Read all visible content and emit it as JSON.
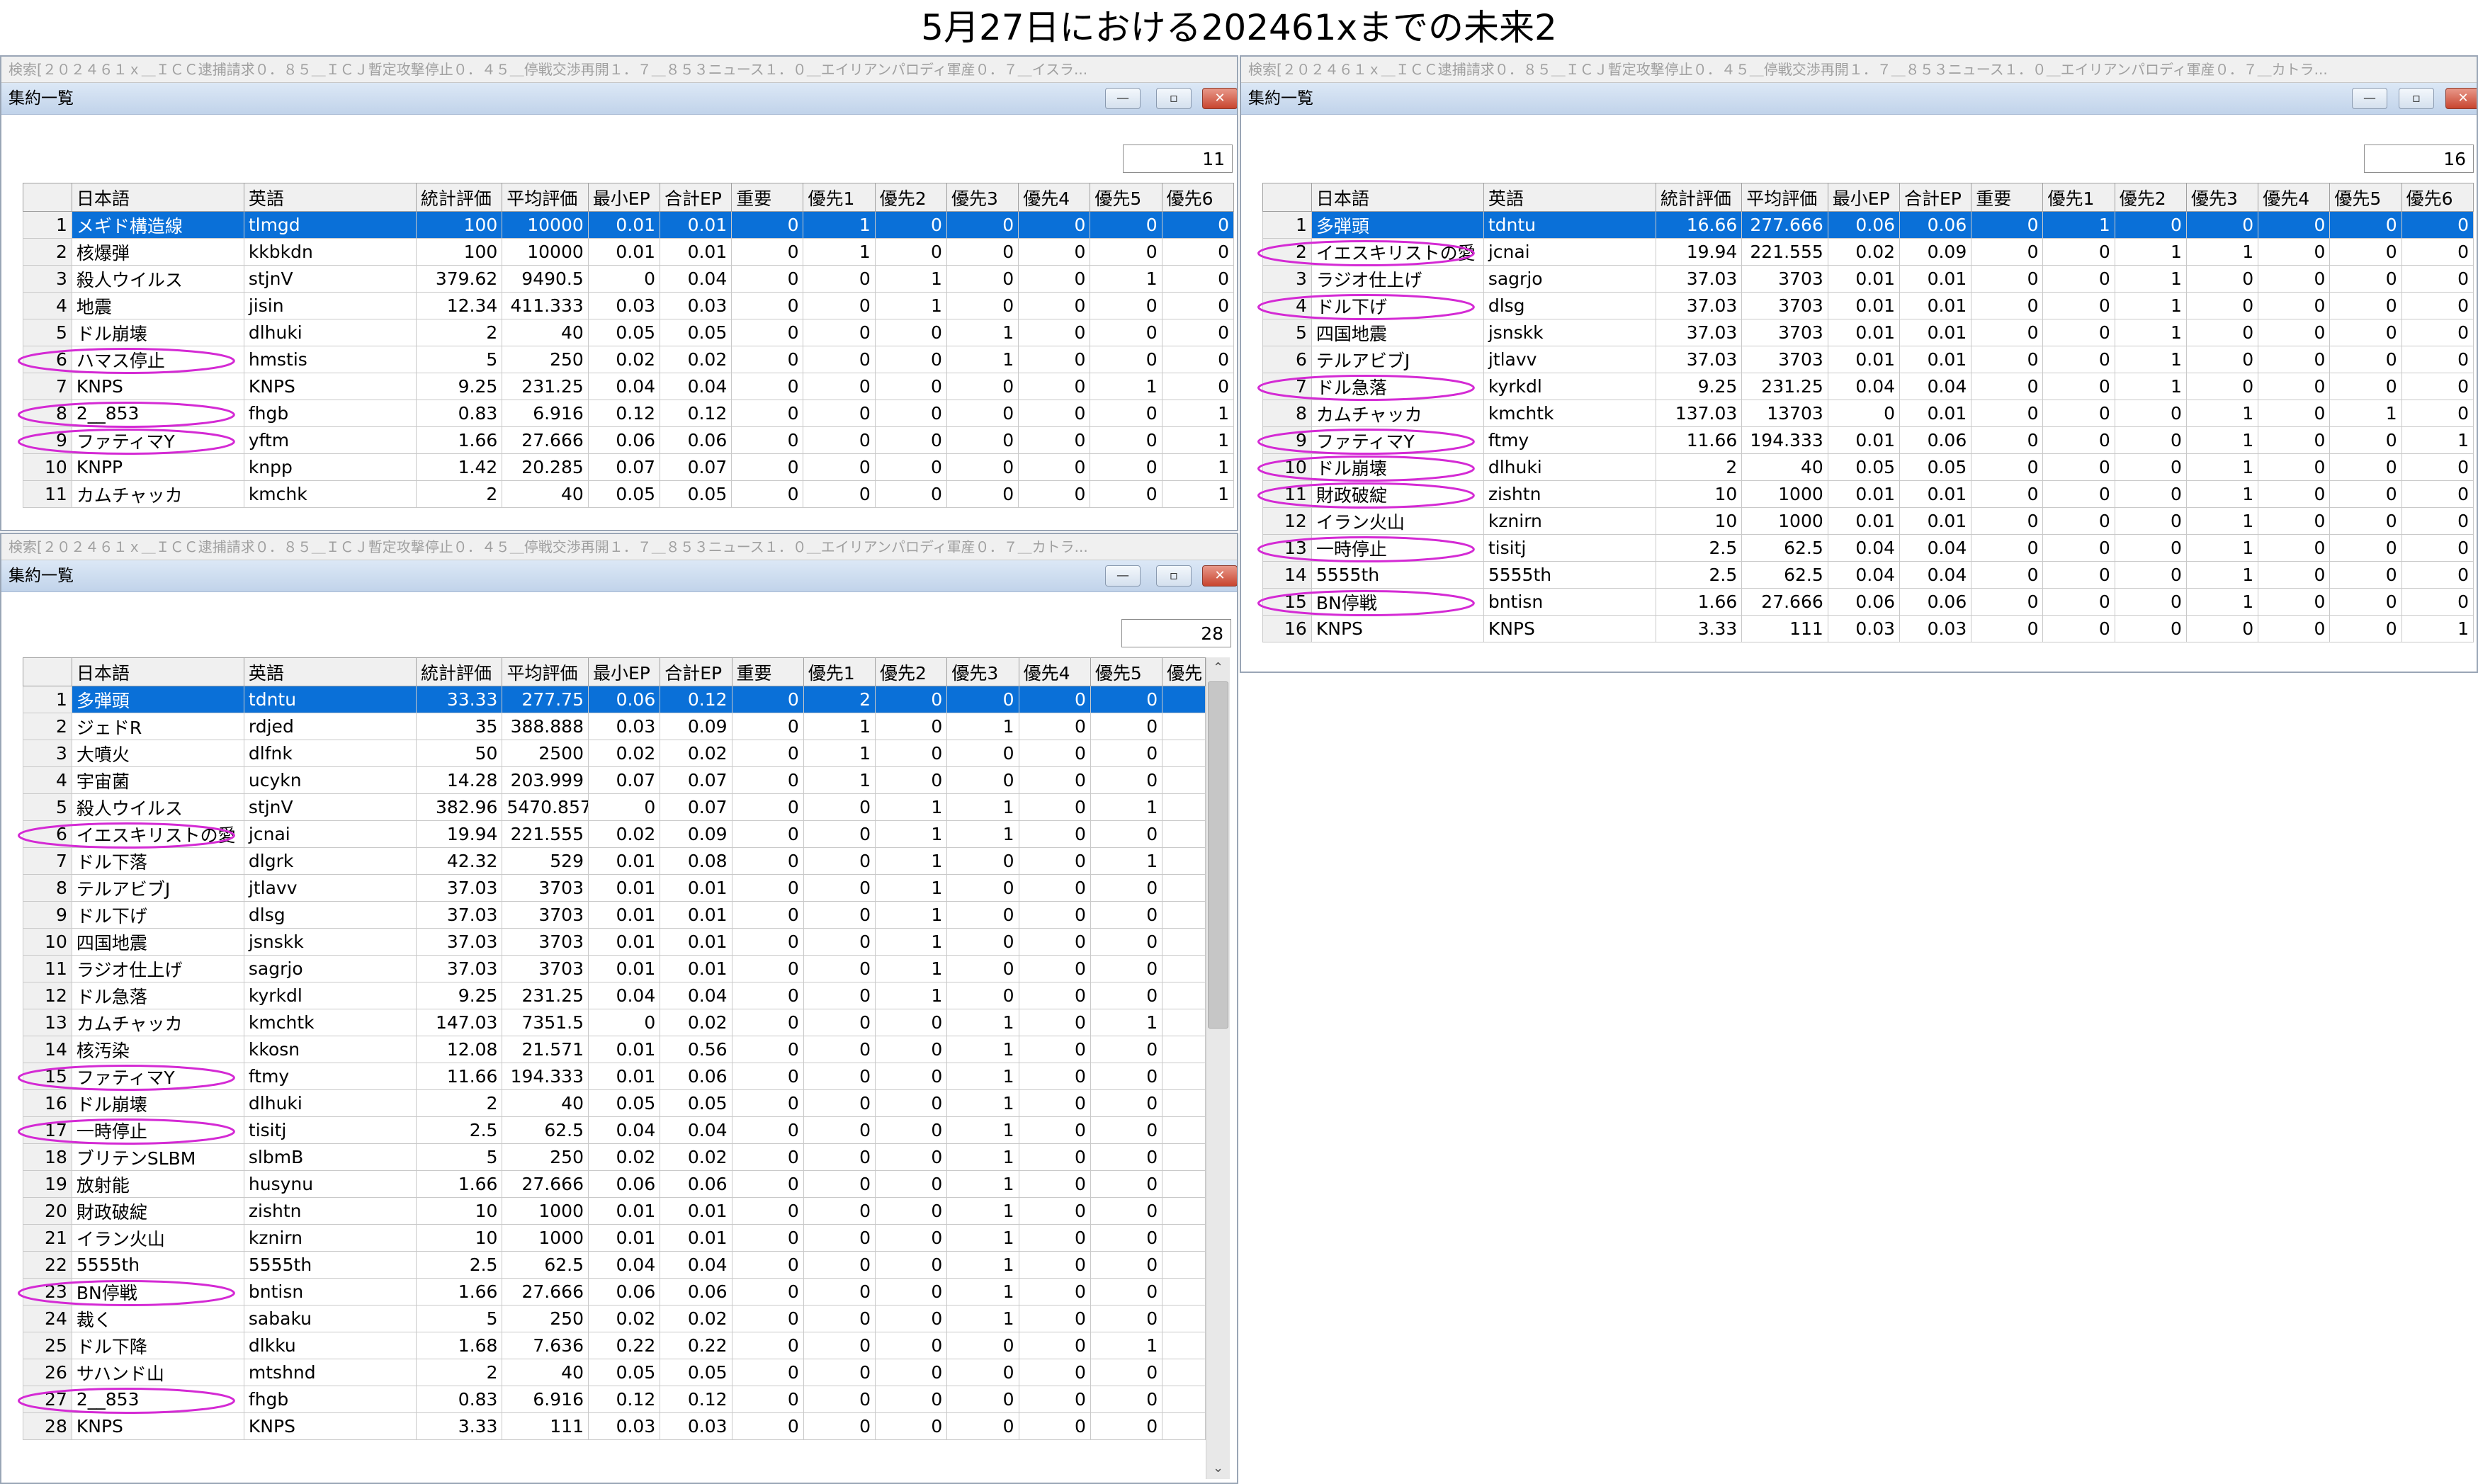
{
  "page": {
    "title": "5月27日における202461xまでの未来2"
  },
  "columns": [
    "日本語",
    "英語",
    "統計評価",
    "平均評価",
    "最小EP",
    "合計EP",
    "重要",
    "優先1",
    "優先2",
    "優先3",
    "優先4",
    "優先5",
    "優先6"
  ],
  "columns_short": [
    "日本語",
    "英語",
    "統計評価",
    "平均評価",
    "最小EP",
    "合計EP",
    "重要",
    "優先1",
    "優先2",
    "優先3",
    "優先4",
    "優先5",
    "優先"
  ],
  "colors": {
    "selection": "#0a70d8",
    "oval": "#d42ad4",
    "close_button": "#c8452f"
  },
  "window_buttons": {
    "minimize": "—",
    "maximize": "▫",
    "close": "✕"
  },
  "scroll_arrows": {
    "up": "⌃",
    "down": "⌄"
  },
  "windows": [
    {
      "id": "top-left",
      "search_text": "検索[２０２４６１ｘ＿ＩＣＣ逮捕請求０．８５＿ＩＣＪ暫定攻撃停止０．４５＿停戦交渉再開１．７＿８５３ニュース１．０＿エイリアンパロディ軍産０．７＿イスラ...",
      "title": "集約一覧",
      "count": "11",
      "rows": [
        {
          "n": "1",
          "ja": "メギド構造線",
          "en": "tlmgd",
          "stat": "100",
          "avg": "10000",
          "min": "0.01",
          "sum": "0.01",
          "imp": "0",
          "p1": "1",
          "p2": "0",
          "p3": "0",
          "p4": "0",
          "p5": "0",
          "p6": "0",
          "sel": true
        },
        {
          "n": "2",
          "ja": "核爆弾",
          "en": "kkbkdn",
          "stat": "100",
          "avg": "10000",
          "min": "0.01",
          "sum": "0.01",
          "imp": "0",
          "p1": "1",
          "p2": "0",
          "p3": "0",
          "p4": "0",
          "p5": "0",
          "p6": "0"
        },
        {
          "n": "3",
          "ja": "殺人ウイルス",
          "en": "stjnV",
          "stat": "379.62",
          "avg": "9490.5",
          "min": "0",
          "sum": "0.04",
          "imp": "0",
          "p1": "0",
          "p2": "1",
          "p3": "0",
          "p4": "0",
          "p5": "1",
          "p6": "0"
        },
        {
          "n": "4",
          "ja": "地震",
          "en": "jisin",
          "stat": "12.34",
          "avg": "411.333",
          "min": "0.03",
          "sum": "0.03",
          "imp": "0",
          "p1": "0",
          "p2": "1",
          "p3": "0",
          "p4": "0",
          "p5": "0",
          "p6": "0"
        },
        {
          "n": "5",
          "ja": "ドル崩壊",
          "en": "dlhuki",
          "stat": "2",
          "avg": "40",
          "min": "0.05",
          "sum": "0.05",
          "imp": "0",
          "p1": "0",
          "p2": "0",
          "p3": "1",
          "p4": "0",
          "p5": "0",
          "p6": "0"
        },
        {
          "n": "6",
          "ja": "ハマス停止",
          "en": "hmstis",
          "stat": "5",
          "avg": "250",
          "min": "0.02",
          "sum": "0.02",
          "imp": "0",
          "p1": "0",
          "p2": "0",
          "p3": "1",
          "p4": "0",
          "p5": "0",
          "p6": "0",
          "oval": true
        },
        {
          "n": "7",
          "ja": "KNPS",
          "en": "KNPS",
          "stat": "9.25",
          "avg": "231.25",
          "min": "0.04",
          "sum": "0.04",
          "imp": "0",
          "p1": "0",
          "p2": "0",
          "p3": "0",
          "p4": "0",
          "p5": "1",
          "p6": "0"
        },
        {
          "n": "8",
          "ja": "2__853",
          "en": "fhgb",
          "stat": "0.83",
          "avg": "6.916",
          "min": "0.12",
          "sum": "0.12",
          "imp": "0",
          "p1": "0",
          "p2": "0",
          "p3": "0",
          "p4": "0",
          "p5": "0",
          "p6": "1",
          "oval": true
        },
        {
          "n": "9",
          "ja": "ファティマY",
          "en": "yftm",
          "stat": "1.66",
          "avg": "27.666",
          "min": "0.06",
          "sum": "0.06",
          "imp": "0",
          "p1": "0",
          "p2": "0",
          "p3": "0",
          "p4": "0",
          "p5": "0",
          "p6": "1",
          "oval": true
        },
        {
          "n": "10",
          "ja": "KNPP",
          "en": "knpp",
          "stat": "1.42",
          "avg": "20.285",
          "min": "0.07",
          "sum": "0.07",
          "imp": "0",
          "p1": "0",
          "p2": "0",
          "p3": "0",
          "p4": "0",
          "p5": "0",
          "p6": "1"
        },
        {
          "n": "11",
          "ja": "カムチャッカ",
          "en": "kmchk",
          "stat": "2",
          "avg": "40",
          "min": "0.05",
          "sum": "0.05",
          "imp": "0",
          "p1": "0",
          "p2": "0",
          "p3": "0",
          "p4": "0",
          "p5": "0",
          "p6": "1"
        }
      ]
    },
    {
      "id": "top-right",
      "search_text": "検索[２０２４６１ｘ＿ＩＣＣ逮捕請求０．８５＿ＩＣＪ暫定攻撃停止０．４５＿停戦交渉再開１．７＿８５３ニュース１．０＿エイリアンパロディ軍産０．７＿カトラ...",
      "title": "集約一覧",
      "count": "16",
      "rows": [
        {
          "n": "1",
          "ja": "多弾頭",
          "en": "tdntu",
          "stat": "16.66",
          "avg": "277.666",
          "min": "0.06",
          "sum": "0.06",
          "imp": "0",
          "p1": "1",
          "p2": "0",
          "p3": "0",
          "p4": "0",
          "p5": "0",
          "p6": "0",
          "sel": true
        },
        {
          "n": "2",
          "ja": "イエスキリストの愛",
          "en": "jcnai",
          "stat": "19.94",
          "avg": "221.555",
          "min": "0.02",
          "sum": "0.09",
          "imp": "0",
          "p1": "0",
          "p2": "1",
          "p3": "1",
          "p4": "0",
          "p5": "0",
          "p6": "0",
          "oval": true
        },
        {
          "n": "3",
          "ja": "ラジオ仕上げ",
          "en": "sagrjo",
          "stat": "37.03",
          "avg": "3703",
          "min": "0.01",
          "sum": "0.01",
          "imp": "0",
          "p1": "0",
          "p2": "1",
          "p3": "0",
          "p4": "0",
          "p5": "0",
          "p6": "0"
        },
        {
          "n": "4",
          "ja": "ドル下げ",
          "en": "dlsg",
          "stat": "37.03",
          "avg": "3703",
          "min": "0.01",
          "sum": "0.01",
          "imp": "0",
          "p1": "0",
          "p2": "1",
          "p3": "0",
          "p4": "0",
          "p5": "0",
          "p6": "0",
          "oval": true
        },
        {
          "n": "5",
          "ja": "四国地震",
          "en": "jsnskk",
          "stat": "37.03",
          "avg": "3703",
          "min": "0.01",
          "sum": "0.01",
          "imp": "0",
          "p1": "0",
          "p2": "1",
          "p3": "0",
          "p4": "0",
          "p5": "0",
          "p6": "0"
        },
        {
          "n": "6",
          "ja": "テルアビブJ",
          "en": "jtlavv",
          "stat": "37.03",
          "avg": "3703",
          "min": "0.01",
          "sum": "0.01",
          "imp": "0",
          "p1": "0",
          "p2": "1",
          "p3": "0",
          "p4": "0",
          "p5": "0",
          "p6": "0"
        },
        {
          "n": "7",
          "ja": "ドル急落",
          "en": "kyrkdl",
          "stat": "9.25",
          "avg": "231.25",
          "min": "0.04",
          "sum": "0.04",
          "imp": "0",
          "p1": "0",
          "p2": "1",
          "p3": "0",
          "p4": "0",
          "p5": "0",
          "p6": "0",
          "oval": true
        },
        {
          "n": "8",
          "ja": "カムチャッカ",
          "en": "kmchtk",
          "stat": "137.03",
          "avg": "13703",
          "min": "0",
          "sum": "0.01",
          "imp": "0",
          "p1": "0",
          "p2": "0",
          "p3": "1",
          "p4": "0",
          "p5": "1",
          "p6": "0"
        },
        {
          "n": "9",
          "ja": "ファティマY",
          "en": "ftmy",
          "stat": "11.66",
          "avg": "194.333",
          "min": "0.01",
          "sum": "0.06",
          "imp": "0",
          "p1": "0",
          "p2": "0",
          "p3": "1",
          "p4": "0",
          "p5": "0",
          "p6": "1",
          "oval": true
        },
        {
          "n": "10",
          "ja": "ドル崩壊",
          "en": "dlhuki",
          "stat": "2",
          "avg": "40",
          "min": "0.05",
          "sum": "0.05",
          "imp": "0",
          "p1": "0",
          "p2": "0",
          "p3": "1",
          "p4": "0",
          "p5": "0",
          "p6": "0",
          "oval": true
        },
        {
          "n": "11",
          "ja": "財政破綻",
          "en": "zishtn",
          "stat": "10",
          "avg": "1000",
          "min": "0.01",
          "sum": "0.01",
          "imp": "0",
          "p1": "0",
          "p2": "0",
          "p3": "1",
          "p4": "0",
          "p5": "0",
          "p6": "0",
          "oval": true
        },
        {
          "n": "12",
          "ja": "イラン火山",
          "en": "kznirn",
          "stat": "10",
          "avg": "1000",
          "min": "0.01",
          "sum": "0.01",
          "imp": "0",
          "p1": "0",
          "p2": "0",
          "p3": "1",
          "p4": "0",
          "p5": "0",
          "p6": "0"
        },
        {
          "n": "13",
          "ja": "一時停止",
          "en": "tisitj",
          "stat": "2.5",
          "avg": "62.5",
          "min": "0.04",
          "sum": "0.04",
          "imp": "0",
          "p1": "0",
          "p2": "0",
          "p3": "1",
          "p4": "0",
          "p5": "0",
          "p6": "0",
          "oval": true
        },
        {
          "n": "14",
          "ja": "5555th",
          "en": "5555th",
          "stat": "2.5",
          "avg": "62.5",
          "min": "0.04",
          "sum": "0.04",
          "imp": "0",
          "p1": "0",
          "p2": "0",
          "p3": "1",
          "p4": "0",
          "p5": "0",
          "p6": "0"
        },
        {
          "n": "15",
          "ja": "BN停戦",
          "en": "bntisn",
          "stat": "1.66",
          "avg": "27.666",
          "min": "0.06",
          "sum": "0.06",
          "imp": "0",
          "p1": "0",
          "p2": "0",
          "p3": "1",
          "p4": "0",
          "p5": "0",
          "p6": "0",
          "oval": true
        },
        {
          "n": "16",
          "ja": "KNPS",
          "en": "KNPS",
          "stat": "3.33",
          "avg": "111",
          "min": "0.03",
          "sum": "0.03",
          "imp": "0",
          "p1": "0",
          "p2": "0",
          "p3": "0",
          "p4": "0",
          "p5": "0",
          "p6": "1"
        }
      ]
    },
    {
      "id": "bottom-left",
      "search_text": "検索[２０２４６１ｘ＿ＩＣＣ逮捕請求０．８５＿ＩＣＪ暫定攻撃停止０．４５＿停戦交渉再開１．７＿８５３ニュース１．０＿エイリアンパロディ軍産０．７＿カトラ...",
      "title": "集約一覧",
      "count": "28",
      "rows": [
        {
          "n": "1",
          "ja": "多弾頭",
          "en": "tdntu",
          "stat": "33.33",
          "avg": "277.75",
          "min": "0.06",
          "sum": "0.12",
          "imp": "0",
          "p1": "2",
          "p2": "0",
          "p3": "0",
          "p4": "0",
          "p5": "0",
          "sel": true
        },
        {
          "n": "2",
          "ja": "ジェドR",
          "en": "rdjed",
          "stat": "35",
          "avg": "388.888",
          "min": "0.03",
          "sum": "0.09",
          "imp": "0",
          "p1": "1",
          "p2": "0",
          "p3": "1",
          "p4": "0",
          "p5": "0"
        },
        {
          "n": "3",
          "ja": "大噴火",
          "en": "dlfnk",
          "stat": "50",
          "avg": "2500",
          "min": "0.02",
          "sum": "0.02",
          "imp": "0",
          "p1": "1",
          "p2": "0",
          "p3": "0",
          "p4": "0",
          "p5": "0"
        },
        {
          "n": "4",
          "ja": "宇宙菌",
          "en": "ucykn",
          "stat": "14.28",
          "avg": "203.999",
          "min": "0.07",
          "sum": "0.07",
          "imp": "0",
          "p1": "1",
          "p2": "0",
          "p3": "0",
          "p4": "0",
          "p5": "0"
        },
        {
          "n": "5",
          "ja": "殺人ウイルス",
          "en": "stjnV",
          "stat": "382.96",
          "avg": "5470.857",
          "min": "0",
          "sum": "0.07",
          "imp": "0",
          "p1": "0",
          "p2": "1",
          "p3": "1",
          "p4": "0",
          "p5": "1"
        },
        {
          "n": "6",
          "ja": "イエスキリストの愛",
          "en": "jcnai",
          "stat": "19.94",
          "avg": "221.555",
          "min": "0.02",
          "sum": "0.09",
          "imp": "0",
          "p1": "0",
          "p2": "1",
          "p3": "1",
          "p4": "0",
          "p5": "0",
          "oval": true
        },
        {
          "n": "7",
          "ja": "ドル下落",
          "en": "dlgrk",
          "stat": "42.32",
          "avg": "529",
          "min": "0.01",
          "sum": "0.08",
          "imp": "0",
          "p1": "0",
          "p2": "1",
          "p3": "0",
          "p4": "0",
          "p5": "1"
        },
        {
          "n": "8",
          "ja": "テルアビブJ",
          "en": "jtlavv",
          "stat": "37.03",
          "avg": "3703",
          "min": "0.01",
          "sum": "0.01",
          "imp": "0",
          "p1": "0",
          "p2": "1",
          "p3": "0",
          "p4": "0",
          "p5": "0"
        },
        {
          "n": "9",
          "ja": "ドル下げ",
          "en": "dlsg",
          "stat": "37.03",
          "avg": "3703",
          "min": "0.01",
          "sum": "0.01",
          "imp": "0",
          "p1": "0",
          "p2": "1",
          "p3": "0",
          "p4": "0",
          "p5": "0"
        },
        {
          "n": "10",
          "ja": "四国地震",
          "en": "jsnskk",
          "stat": "37.03",
          "avg": "3703",
          "min": "0.01",
          "sum": "0.01",
          "imp": "0",
          "p1": "0",
          "p2": "1",
          "p3": "0",
          "p4": "0",
          "p5": "0"
        },
        {
          "n": "11",
          "ja": "ラジオ仕上げ",
          "en": "sagrjo",
          "stat": "37.03",
          "avg": "3703",
          "min": "0.01",
          "sum": "0.01",
          "imp": "0",
          "p1": "0",
          "p2": "1",
          "p3": "0",
          "p4": "0",
          "p5": "0"
        },
        {
          "n": "12",
          "ja": "ドル急落",
          "en": "kyrkdl",
          "stat": "9.25",
          "avg": "231.25",
          "min": "0.04",
          "sum": "0.04",
          "imp": "0",
          "p1": "0",
          "p2": "1",
          "p3": "0",
          "p4": "0",
          "p5": "0"
        },
        {
          "n": "13",
          "ja": "カムチャッカ",
          "en": "kmchtk",
          "stat": "147.03",
          "avg": "7351.5",
          "min": "0",
          "sum": "0.02",
          "imp": "0",
          "p1": "0",
          "p2": "0",
          "p3": "1",
          "p4": "0",
          "p5": "1"
        },
        {
          "n": "14",
          "ja": "核汚染",
          "en": "kkosn",
          "stat": "12.08",
          "avg": "21.571",
          "min": "0.01",
          "sum": "0.56",
          "imp": "0",
          "p1": "0",
          "p2": "0",
          "p3": "1",
          "p4": "0",
          "p5": "0"
        },
        {
          "n": "15",
          "ja": "ファティマY",
          "en": "ftmy",
          "stat": "11.66",
          "avg": "194.333",
          "min": "0.01",
          "sum": "0.06",
          "imp": "0",
          "p1": "0",
          "p2": "0",
          "p3": "1",
          "p4": "0",
          "p5": "0",
          "oval": true
        },
        {
          "n": "16",
          "ja": "ドル崩壊",
          "en": "dlhuki",
          "stat": "2",
          "avg": "40",
          "min": "0.05",
          "sum": "0.05",
          "imp": "0",
          "p1": "0",
          "p2": "0",
          "p3": "1",
          "p4": "0",
          "p5": "0"
        },
        {
          "n": "17",
          "ja": "一時停止",
          "en": "tisitj",
          "stat": "2.5",
          "avg": "62.5",
          "min": "0.04",
          "sum": "0.04",
          "imp": "0",
          "p1": "0",
          "p2": "0",
          "p3": "1",
          "p4": "0",
          "p5": "0",
          "oval": true
        },
        {
          "n": "18",
          "ja": "ブリテンSLBM",
          "en": "slbmB",
          "stat": "5",
          "avg": "250",
          "min": "0.02",
          "sum": "0.02",
          "imp": "0",
          "p1": "0",
          "p2": "0",
          "p3": "1",
          "p4": "0",
          "p5": "0"
        },
        {
          "n": "19",
          "ja": "放射能",
          "en": "husynu",
          "stat": "1.66",
          "avg": "27.666",
          "min": "0.06",
          "sum": "0.06",
          "imp": "0",
          "p1": "0",
          "p2": "0",
          "p3": "1",
          "p4": "0",
          "p5": "0"
        },
        {
          "n": "20",
          "ja": "財政破綻",
          "en": "zishtn",
          "stat": "10",
          "avg": "1000",
          "min": "0.01",
          "sum": "0.01",
          "imp": "0",
          "p1": "0",
          "p2": "0",
          "p3": "1",
          "p4": "0",
          "p5": "0"
        },
        {
          "n": "21",
          "ja": "イラン火山",
          "en": "kznirn",
          "stat": "10",
          "avg": "1000",
          "min": "0.01",
          "sum": "0.01",
          "imp": "0",
          "p1": "0",
          "p2": "0",
          "p3": "1",
          "p4": "0",
          "p5": "0"
        },
        {
          "n": "22",
          "ja": "5555th",
          "en": "5555th",
          "stat": "2.5",
          "avg": "62.5",
          "min": "0.04",
          "sum": "0.04",
          "imp": "0",
          "p1": "0",
          "p2": "0",
          "p3": "1",
          "p4": "0",
          "p5": "0"
        },
        {
          "n": "23",
          "ja": "BN停戦",
          "en": "bntisn",
          "stat": "1.66",
          "avg": "27.666",
          "min": "0.06",
          "sum": "0.06",
          "imp": "0",
          "p1": "0",
          "p2": "0",
          "p3": "1",
          "p4": "0",
          "p5": "0",
          "oval": true
        },
        {
          "n": "24",
          "ja": "裁く",
          "en": "sabaku",
          "stat": "5",
          "avg": "250",
          "min": "0.02",
          "sum": "0.02",
          "imp": "0",
          "p1": "0",
          "p2": "0",
          "p3": "1",
          "p4": "0",
          "p5": "0"
        },
        {
          "n": "25",
          "ja": "ドル下降",
          "en": "dlkku",
          "stat": "1.68",
          "avg": "7.636",
          "min": "0.22",
          "sum": "0.22",
          "imp": "0",
          "p1": "0",
          "p2": "0",
          "p3": "0",
          "p4": "0",
          "p5": "1"
        },
        {
          "n": "26",
          "ja": "サハンド山",
          "en": "mtshnd",
          "stat": "2",
          "avg": "40",
          "min": "0.05",
          "sum": "0.05",
          "imp": "0",
          "p1": "0",
          "p2": "0",
          "p3": "0",
          "p4": "0",
          "p5": "0"
        },
        {
          "n": "27",
          "ja": "2__853",
          "en": "fhgb",
          "stat": "0.83",
          "avg": "6.916",
          "min": "0.12",
          "sum": "0.12",
          "imp": "0",
          "p1": "0",
          "p2": "0",
          "p3": "0",
          "p4": "0",
          "p5": "0",
          "oval": true
        },
        {
          "n": "28",
          "ja": "KNPS",
          "en": "KNPS",
          "stat": "3.33",
          "avg": "111",
          "min": "0.03",
          "sum": "0.03",
          "imp": "0",
          "p1": "0",
          "p2": "0",
          "p3": "0",
          "p4": "0",
          "p5": "0"
        }
      ]
    }
  ]
}
